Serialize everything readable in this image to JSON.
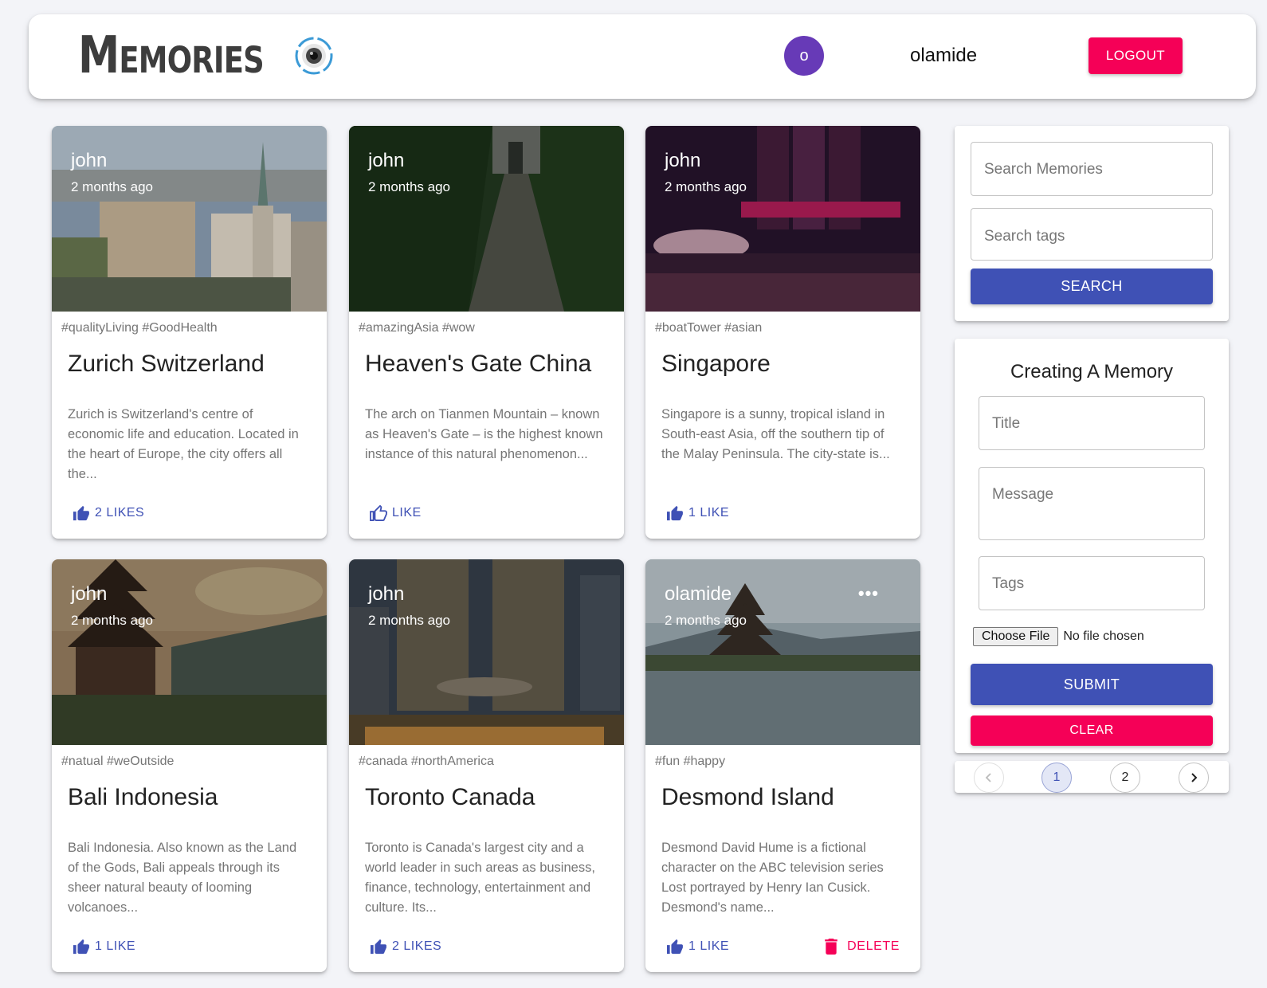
{
  "header": {
    "brand": "Memories",
    "avatar_initial": "o",
    "username": "olamide",
    "logout_label": "LOGOUT"
  },
  "posts": [
    {
      "creator": "john",
      "time": "2 months ago",
      "tags": "#qualityLiving #GoodHealth",
      "title": "Zurich Switzerland",
      "message": "Zurich is Switzerland's centre of economic life and education. Located in the heart of Europe, the city offers all the...",
      "like_label": "2 LIKES"
    },
    {
      "creator": "john",
      "time": "2 months ago",
      "tags": "#amazingAsia #wow",
      "title": "Heaven's Gate China",
      "message": "The arch on Tianmen Mountain – known as Heaven's Gate – is the highest known instance of this natural phenomenon...",
      "like_label": "LIKE"
    },
    {
      "creator": "john",
      "time": "2 months ago",
      "tags": "#boatTower #asian",
      "title": "Singapore",
      "message": "Singapore is a sunny, tropical island in South-east Asia, off the southern tip of the Malay Peninsula. The city-state is...",
      "like_label": "1 LIKE"
    },
    {
      "creator": "john",
      "time": "2 months ago",
      "tags": "#natual #weOutside",
      "title": "Bali Indonesia",
      "message": "Bali Indonesia. Also known as the Land of the Gods, Bali appeals through its sheer natural beauty of looming volcanoes...",
      "like_label": "1 LIKE"
    },
    {
      "creator": "john",
      "time": "2 months ago",
      "tags": "#canada #northAmerica",
      "title": "Toronto Canada",
      "message": "Toronto is Canada's largest city and a world leader in such areas as business, finance, technology, entertainment and culture. Its...",
      "like_label": "2 LIKES"
    },
    {
      "creator": "olamide",
      "time": "2 months ago",
      "tags": "#fun #happy",
      "title": "Desmond Island",
      "message": "Desmond David Hume is a fictional character on the ABC television series Lost portrayed by Henry Ian Cusick. Desmond's name...",
      "like_label": "1 LIKE",
      "more": "•••",
      "delete_label": "DELETE"
    }
  ],
  "search": {
    "memories_placeholder": "Search Memories",
    "tags_placeholder": "Search tags",
    "button_label": "SEARCH"
  },
  "form": {
    "title": "Creating A Memory",
    "title_placeholder": "Title",
    "message_placeholder": "Message",
    "tags_placeholder": "Tags",
    "file_button": "Choose File",
    "file_status": "No file chosen",
    "submit_label": "SUBMIT",
    "clear_label": "CLEAR"
  },
  "pagination": {
    "pages": [
      "1",
      "2"
    ],
    "current": "1"
  },
  "colors": {
    "primary": "#3f51b5",
    "secondary": "#f50057",
    "avatar": "#673ab7"
  }
}
